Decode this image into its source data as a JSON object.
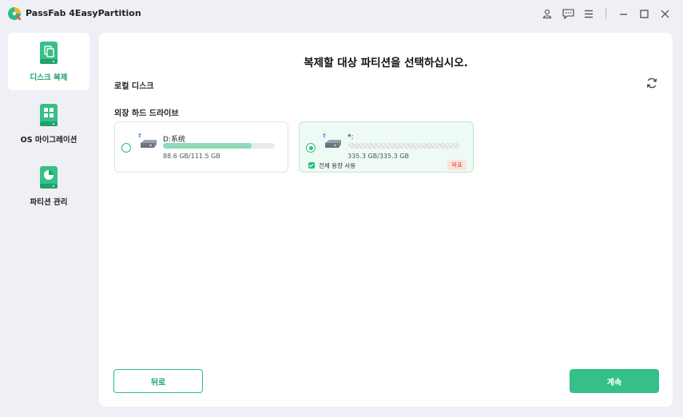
{
  "app": {
    "title": "PassFab 4EasyPartition"
  },
  "titlebar": {
    "icons": [
      "user-icon",
      "message-icon",
      "menu-icon",
      "minimize-icon",
      "maximize-icon",
      "close-icon"
    ]
  },
  "sidebar": {
    "items": [
      {
        "label": "디스크 복제",
        "icon": "disk-clone-icon",
        "active": true
      },
      {
        "label": "OS 마이그레이션",
        "icon": "os-migration-icon",
        "active": false
      },
      {
        "label": "파티션 관리",
        "icon": "partition-manage-icon",
        "active": false
      }
    ]
  },
  "main": {
    "heading": "복제할 대상 파티션을 선택하십시오.",
    "local_disk_label": "로컬 디스크",
    "external_label": "외장 하드 드라이브",
    "cards": [
      {
        "name": "D:系统",
        "size": "88.6 GB/111.5 GB",
        "used_fraction": 0.79,
        "selected": false
      },
      {
        "name": "*:",
        "size": "335.3 GB/335.3 GB",
        "used_fraction": 1.0,
        "selected": true,
        "checkbox_label": "전체 용량 사용",
        "badge": "목표"
      }
    ],
    "back_label": "뒤로",
    "next_label": "계속"
  },
  "colors": {
    "accent": "#2bbd7e",
    "accent_dark": "#1e9e6e",
    "badge_text": "#e04b3c"
  }
}
